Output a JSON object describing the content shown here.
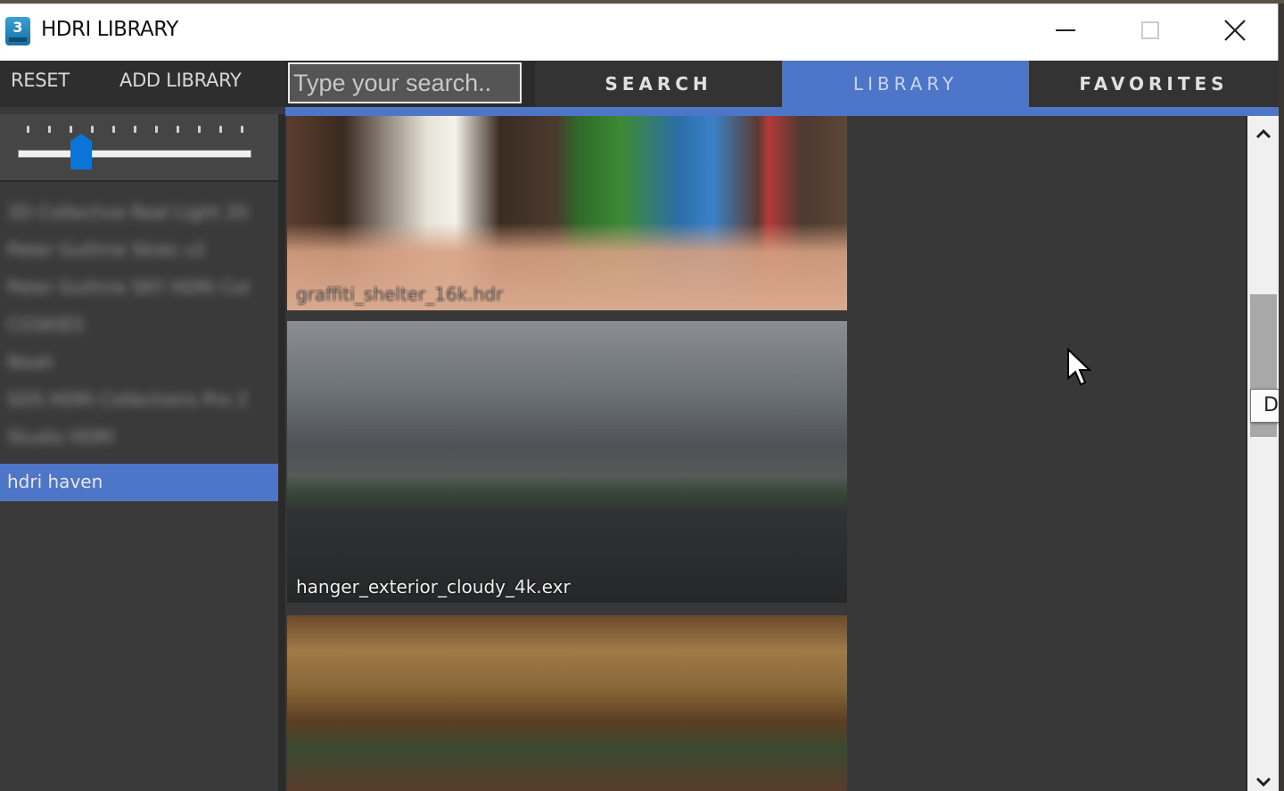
{
  "window": {
    "title": "HDRI LIBRARY",
    "app_icon": "3ds-max-icon",
    "app_icon_label": "3",
    "controls": {
      "minimize": "minimize-icon",
      "maximize": "maximize-icon",
      "close": "close-icon"
    }
  },
  "sidebar": {
    "reset_label": "RESET",
    "add_library_label": "ADD LIBRARY",
    "thumbnail_size_slider": {
      "tick_count": 11,
      "value_fraction": 0.27
    },
    "libraries": [
      {
        "label": "3D Collective Real Light 20",
        "blurred": true
      },
      {
        "label": "Peter Guthrie Skies v2",
        "blurred": true
      },
      {
        "label": "Peter Guthrie SKY HDRI Col",
        "blurred": true
      },
      {
        "label": "CGSKIES",
        "blurred": true
      },
      {
        "label": "Noah",
        "blurred": true
      },
      {
        "label": "SDS HDRI Collections Pro 2",
        "blurred": true
      },
      {
        "label": "Studio HDRI",
        "blurred": true
      },
      {
        "label": "hdri haven",
        "blurred": false,
        "selected": true
      }
    ]
  },
  "search": {
    "placeholder": "Type your search..",
    "value": ""
  },
  "tabs": [
    {
      "label": "SEARCH",
      "active": false
    },
    {
      "label": "LIBRARY",
      "active": true
    },
    {
      "label": "FAVORITES",
      "active": false
    }
  ],
  "colors": {
    "accent": "#4d76c8",
    "background": "#3a3a3a",
    "tab_inactive": "#333333"
  },
  "thumbnails": [
    {
      "caption": "graffiti_shelter_16k.hdr"
    },
    {
      "caption": "hanger_exterior_cloudy_4k.exr"
    },
    {
      "caption": ""
    }
  ],
  "tooltip": {
    "text": "De"
  }
}
